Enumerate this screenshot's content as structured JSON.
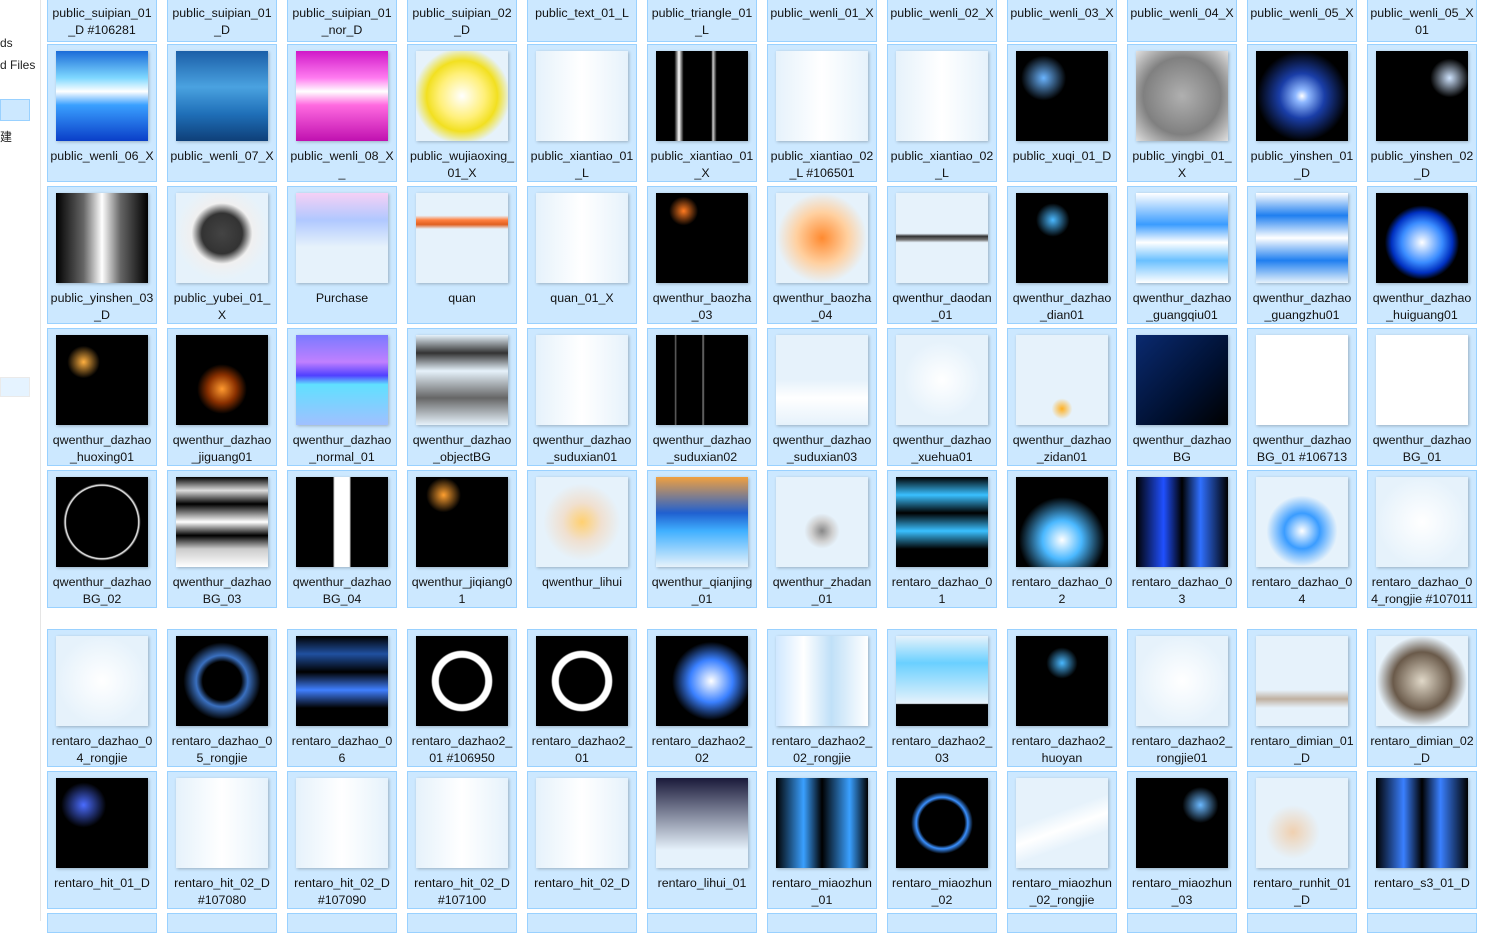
{
  "sidebar": {
    "items": [
      {
        "label": "ds"
      },
      {
        "label": "d Files"
      },
      {
        "label": ""
      },
      {
        "label": "建"
      }
    ]
  },
  "grid": {
    "rows": [
      [
        "public_suipian_01_D #106281",
        "public_suipian_01_D",
        "public_suipian_01_nor_D",
        "public_suipian_02_D",
        "public_text_01_L",
        "public_triangle_01_L",
        "public_wenli_01_X",
        "public_wenli_02_X",
        "public_wenli_03_X",
        "public_wenli_04_X",
        "public_wenli_05_X",
        "public_wenli_05_X01"
      ],
      [
        "public_wenli_06_X",
        "public_wenli_07_X",
        "public_wenli_08_X_",
        "public_wujiaoxing_01_X",
        "public_xiantiao_01_L",
        "public_xiantiao_01_X",
        "public_xiantiao_02_L #106501",
        "public_xiantiao_02_L",
        "public_xuqi_01_D",
        "public_yingbi_01_X",
        "public_yinshen_01_D",
        "public_yinshen_02_D"
      ],
      [
        "public_yinshen_03_D",
        "public_yubei_01_X",
        "Purchase",
        "quan",
        "quan_01_X",
        "qwenthur_baozha_03",
        "qwenthur_baozha_04",
        "qwenthur_daodan_01",
        "qwenthur_dazhao_dian01",
        "qwenthur_dazhao_guangqiu01",
        "qwenthur_dazhao_guangzhu01",
        "qwenthur_dazhao_huiguang01"
      ],
      [
        "qwenthur_dazhao_huoxing01",
        "qwenthur_dazhao_jiguang01",
        "qwenthur_dazhao_normal_01",
        "qwenthur_dazhao_objectBG",
        "qwenthur_dazhao_suduxian01",
        "qwenthur_dazhao_suduxian02",
        "qwenthur_dazhao_suduxian03",
        "qwenthur_dazhao_xuehua01",
        "qwenthur_dazhao_zidan01",
        "qwenthur_dazhaoBG",
        "qwenthur_dazhaoBG_01 #106713",
        "qwenthur_dazhaoBG_01"
      ],
      [
        "qwenthur_dazhaoBG_02",
        "qwenthur_dazhaoBG_03",
        "qwenthur_dazhaoBG_04",
        "qwenthur_jiqiang01",
        "qwenthur_lihui",
        "qwenthur_qianjing_01",
        "qwenthur_zhadan_01",
        "rentaro_dazhao_01",
        "rentaro_dazhao_02",
        "rentaro_dazhao_03",
        "rentaro_dazhao_04",
        "rentaro_dazhao_04_rongjie #107011"
      ],
      [
        "rentaro_dazhao_04_rongjie",
        "rentaro_dazhao_05_rongjie",
        "rentaro_dazhao_06",
        "rentaro_dazhao2_01 #106950",
        "rentaro_dazhao2_01",
        "rentaro_dazhao2_02",
        "rentaro_dazhao2_02_rongjie",
        "rentaro_dazhao2_03",
        "rentaro_dazhao2_huoyan",
        "rentaro_dazhao2_rongjie01",
        "rentaro_dimian_01_D",
        "rentaro_dimian_02_D"
      ],
      [
        "rentaro_hit_01_D",
        "rentaro_hit_02_D #107080",
        "rentaro_hit_02_D #107090",
        "rentaro_hit_02_D #107100",
        "rentaro_hit_02_D",
        "rentaro_lihui_01",
        "rentaro_miaozhun_01",
        "rentaro_miaozhun_02",
        "rentaro_miaozhun_02_rongjie",
        "rentaro_miaozhun_03",
        "rentaro_runhit_01_D",
        "rentaro_s3_01_D"
      ],
      [
        "",
        "",
        "",
        "",
        "",
        "",
        "",
        "",
        "",
        "",
        "",
        ""
      ]
    ]
  },
  "colors": {
    "tile_bg": "#cce8ff",
    "tile_border": "#99d1ff",
    "sidebar_selected": "#cce8ff"
  }
}
